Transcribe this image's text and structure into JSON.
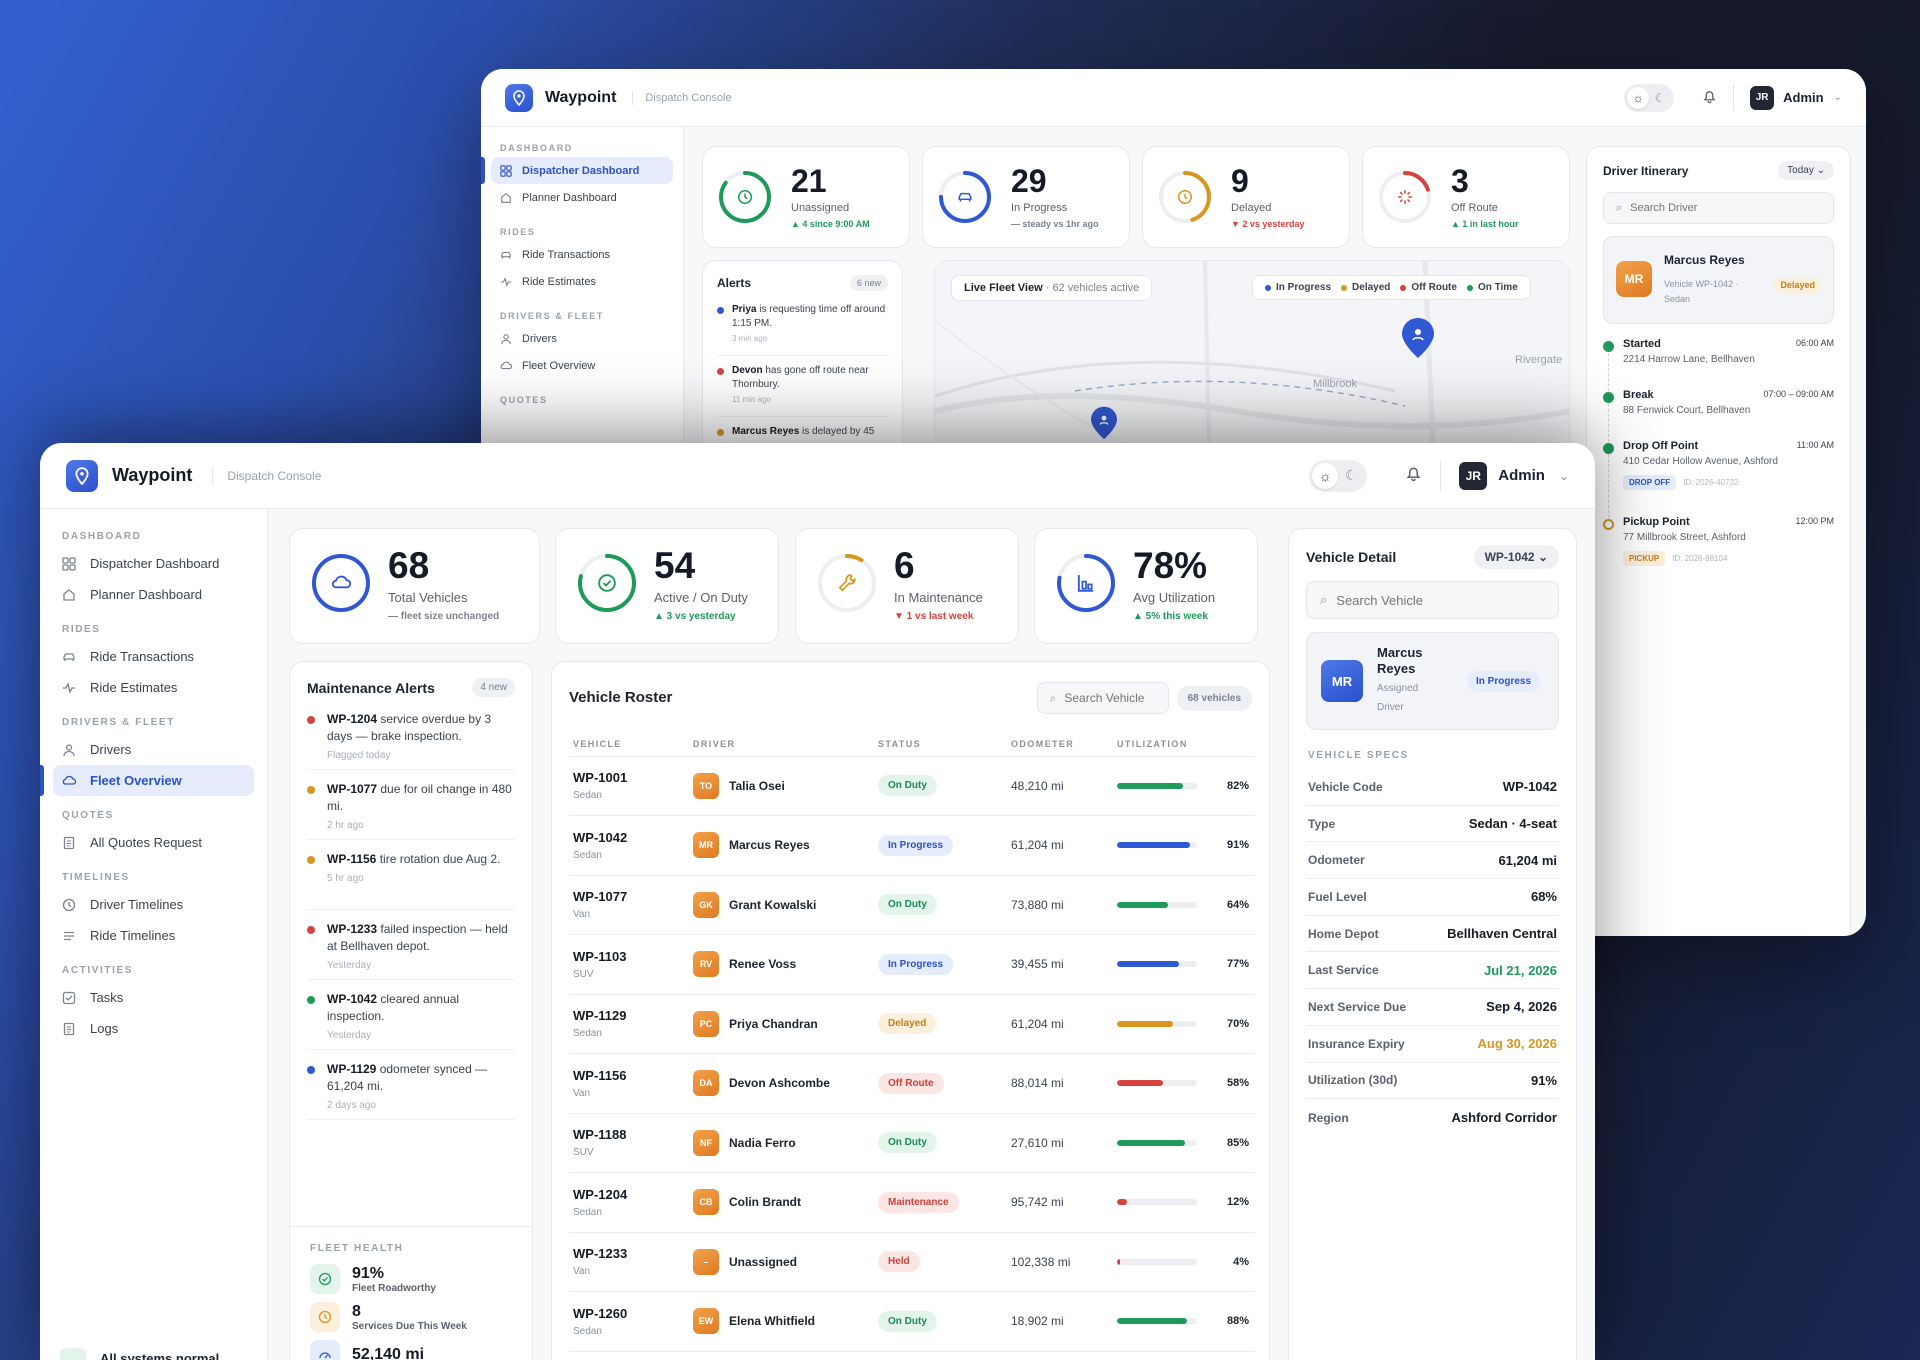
{
  "brand": {
    "name": "Waypoint",
    "subtitle": "Dispatch Console"
  },
  "admin": {
    "initials": "JR",
    "name": "Admin"
  },
  "colors": {
    "accent": "#2d52c6",
    "green": "#1e9a5b",
    "amber": "#d9961f",
    "red": "#d6433e",
    "blue": "#3158d3"
  },
  "back": {
    "sidebar": {
      "sections": [
        {
          "title": "DASHBOARD",
          "items": [
            {
              "label": "Dispatcher Dashboard",
              "icon": "grid-icon",
              "active": true
            },
            {
              "label": "Planner Dashboard",
              "icon": "home-icon"
            }
          ]
        },
        {
          "title": "RIDES",
          "items": [
            {
              "label": "Ride Transactions",
              "icon": "car-icon"
            },
            {
              "label": "Ride Estimates",
              "icon": "pulse-icon"
            }
          ]
        },
        {
          "title": "DRIVERS & FLEET",
          "items": [
            {
              "label": "Drivers",
              "icon": "person-icon"
            },
            {
              "label": "Fleet Overview",
              "icon": "cloud-icon"
            }
          ]
        },
        {
          "title": "QUOTES",
          "items": []
        }
      ]
    },
    "kpis": [
      {
        "num": "21",
        "label": "Unassigned",
        "delta": "▲ 4 since 9:00 AM",
        "trend": "up",
        "icon": "clock-icon",
        "ring": "#1e9a5b",
        "fill": 0.85
      },
      {
        "num": "29",
        "label": "In Progress",
        "delta": "— steady vs 1hr ago",
        "trend": "flat",
        "icon": "car-icon",
        "ring": "#3158d3",
        "fill": 0.75
      },
      {
        "num": "9",
        "label": "Delayed",
        "delta": "▼ 2 vs yesterday",
        "trend": "down",
        "icon": "clock-icon",
        "ring": "#d9961f",
        "fill": 0.45
      },
      {
        "num": "3",
        "label": "Off Route",
        "delta": "▲ 1 in last hour",
        "trend": "up",
        "icon": "spinner-icon",
        "ring": "#d6433e",
        "fill": 0.2
      }
    ],
    "alerts": {
      "title": "Alerts",
      "badge": "6 new",
      "items": [
        {
          "bold": "Priya",
          "text": " is requesting time off around 1:15 PM.",
          "time": "3 min ago",
          "color": "#3158d3"
        },
        {
          "bold": "Devon",
          "text": " has gone off route near Thornbury.",
          "time": "11 min ago",
          "color": "#d6433e"
        },
        {
          "bold": "Marcus Reyes",
          "text": " is delayed by 45",
          "time": "",
          "color": "#d9961f"
        }
      ]
    },
    "map": {
      "title": "Live Fleet View",
      "subtitle": " · 62 vehicles active",
      "legend": [
        {
          "label": "In Progress",
          "color": "#3158d3"
        },
        {
          "label": "Delayed",
          "color": "#d9961f"
        },
        {
          "label": "Off Route",
          "color": "#d6433e"
        },
        {
          "label": "On Time",
          "color": "#1e9a5b"
        }
      ],
      "places": [
        "Millbrook",
        "Rivergate"
      ]
    },
    "itinerary": {
      "title": "Driver Itinerary",
      "range": "Today",
      "search_placeholder": "Search Driver",
      "driver": {
        "initials": "MR",
        "name": "Marcus Reyes",
        "vehicle": "Vehicle WP-1042 · Sedan",
        "status": "Delayed"
      },
      "stops": [
        {
          "title": "Started",
          "time": "06:00 AM",
          "addr": "2214 Harrow Lane, Bellhaven",
          "tag": "",
          "id": "",
          "color": "#1e9a5b",
          "hollow": false
        },
        {
          "title": "Break",
          "time": "07:00 – 09:00 AM",
          "addr": "88 Fenwick Court, Bellhaven",
          "tag": "",
          "id": "",
          "color": "#1e9a5b",
          "hollow": false
        },
        {
          "title": "Drop Off Point",
          "time": "11:00 AM",
          "addr": "410 Cedar Hollow Avenue, Ashford",
          "tag": "DROP OFF",
          "id": "ID: 2026-40732",
          "color": "#1e9a5b",
          "hollow": false
        },
        {
          "title": "Pickup Point",
          "time": "12:00 PM",
          "addr": "77 Millbrook Street, Ashford",
          "tag": "PICKUP",
          "id": "ID: 2026-88104",
          "color": "#d9961f",
          "hollow": true
        }
      ]
    }
  },
  "front": {
    "sidebar": {
      "sections": [
        {
          "title": "DASHBOARD",
          "items": [
            {
              "label": "Dispatcher Dashboard",
              "icon": "grid-icon"
            },
            {
              "label": "Planner Dashboard",
              "icon": "home-icon"
            }
          ]
        },
        {
          "title": "RIDES",
          "items": [
            {
              "label": "Ride Transactions",
              "icon": "car-icon"
            },
            {
              "label": "Ride Estimates",
              "icon": "pulse-icon"
            }
          ]
        },
        {
          "title": "DRIVERS & FLEET",
          "items": [
            {
              "label": "Drivers",
              "icon": "person-icon"
            },
            {
              "label": "Fleet Overview",
              "icon": "cloud-icon",
              "active": true
            }
          ]
        },
        {
          "title": "QUOTES",
          "items": [
            {
              "label": "All Quotes Request",
              "icon": "document-icon"
            }
          ]
        },
        {
          "title": "TIMELINES",
          "items": [
            {
              "label": "Driver Timelines",
              "icon": "clock-icon"
            },
            {
              "label": "Ride Timelines",
              "icon": "lines-icon"
            }
          ]
        },
        {
          "title": "ACTIVITIES",
          "items": [
            {
              "label": "Tasks",
              "icon": "checkbox-icon"
            },
            {
              "label": "Logs",
              "icon": "document-icon"
            }
          ]
        }
      ],
      "footer": "All systems normal"
    },
    "kpis": [
      {
        "num": "68",
        "label": "Total Vehicles",
        "delta": "— fleet size unchanged",
        "trend": "flat",
        "icon": "cloud-icon",
        "ring": "#3158d3",
        "fill": 1
      },
      {
        "num": "54",
        "label": "Active / On Duty",
        "delta": "▲ 3 vs yesterday",
        "trend": "up",
        "icon": "check-circle-icon",
        "ring": "#1e9a5b",
        "fill": 0.79
      },
      {
        "num": "6",
        "label": "In Maintenance",
        "delta": "▼ 1 vs last week",
        "trend": "down",
        "icon": "wrench-icon",
        "ring": "#d9961f",
        "fill": 0.09
      },
      {
        "num": "78%",
        "label": "Avg Utilization",
        "delta": "▲ 5% this week",
        "trend": "up",
        "icon": "chart-icon",
        "ring": "#3158d3",
        "fill": 0.78
      }
    ],
    "maintenance": {
      "title": "Maintenance Alerts",
      "badge": "4 new",
      "items": [
        {
          "bold": "WP-1204",
          "text": " service overdue by 3 days — brake inspection.",
          "time": "Flagged today",
          "color": "#d6433e"
        },
        {
          "bold": "WP-1077",
          "text": " due for oil change in 480 mi.",
          "time": "2 hr ago",
          "color": "#d9961f"
        },
        {
          "bold": "WP-1156",
          "text": " tire rotation due Aug 2.",
          "time": "5 hr ago",
          "color": "#d9961f"
        },
        {
          "bold": "WP-1233",
          "text": " failed inspection — held at Bellhaven depot.",
          "time": "Yesterday",
          "color": "#d6433e"
        },
        {
          "bold": "WP-1042",
          "text": " cleared annual inspection.",
          "time": "Yesterday",
          "color": "#1e9a5b"
        },
        {
          "bold": "WP-1129",
          "text": " odometer synced — 61,204 mi.",
          "time": "2 days ago",
          "color": "#3158d3"
        }
      ],
      "health_title": "FLEET HEALTH",
      "health": [
        {
          "value": "91%",
          "label": "Fleet Roadworthy",
          "icon": "check-circle-icon",
          "color": "#1e9a5b",
          "bg": "#e3f5ea"
        },
        {
          "value": "8",
          "label": "Services Due This Week",
          "icon": "clock-icon",
          "color": "#d9961f",
          "bg": "#fcefdc"
        },
        {
          "value": "52,140 mi",
          "label": "",
          "icon": "gauge-icon",
          "color": "#3158d3",
          "bg": "#e5ecfc"
        }
      ]
    },
    "roster": {
      "title": "Vehicle Roster",
      "search_placeholder": "Search Vehicle",
      "count": "68 vehicles",
      "columns": [
        "VEHICLE",
        "DRIVER",
        "STATUS",
        "ODOMETER",
        "UTILIZATION"
      ],
      "rows": [
        {
          "id": "WP-1001",
          "type": "Sedan",
          "initials": "TO",
          "driver": "Talia Osei",
          "status": "On Duty",
          "tone": "green",
          "odo": "48,210 mi",
          "util": 82
        },
        {
          "id": "WP-1042",
          "type": "Sedan",
          "initials": "MR",
          "driver": "Marcus Reyes",
          "status": "In Progress",
          "tone": "blue",
          "odo": "61,204 mi",
          "util": 91
        },
        {
          "id": "WP-1077",
          "type": "Van",
          "initials": "GK",
          "driver": "Grant Kowalski",
          "status": "On Duty",
          "tone": "green",
          "odo": "73,880 mi",
          "util": 64
        },
        {
          "id": "WP-1103",
          "type": "SUV",
          "initials": "RV",
          "driver": "Renee Voss",
          "status": "In Progress",
          "tone": "blue",
          "odo": "39,455 mi",
          "util": 77
        },
        {
          "id": "WP-1129",
          "type": "Sedan",
          "initials": "PC",
          "driver": "Priya Chandran",
          "status": "Delayed",
          "tone": "amber",
          "odo": "61,204 mi",
          "util": 70
        },
        {
          "id": "WP-1156",
          "type": "Van",
          "initials": "DA",
          "driver": "Devon Ashcombe",
          "status": "Off Route",
          "tone": "red",
          "odo": "88,014 mi",
          "util": 58
        },
        {
          "id": "WP-1188",
          "type": "SUV",
          "initials": "NF",
          "driver": "Nadia Ferro",
          "status": "On Duty",
          "tone": "green",
          "odo": "27,610 mi",
          "util": 85
        },
        {
          "id": "WP-1204",
          "type": "Sedan",
          "initials": "CB",
          "driver": "Colin Brandt",
          "status": "Maintenance",
          "tone": "red",
          "odo": "95,742 mi",
          "util": 12
        },
        {
          "id": "WP-1233",
          "type": "Van",
          "initials": "–",
          "driver": "Unassigned",
          "status": "Held",
          "tone": "red",
          "odo": "102,338 mi",
          "util": 4
        },
        {
          "id": "WP-1260",
          "type": "Sedan",
          "initials": "EW",
          "driver": "Elena Whitfield",
          "status": "On Duty",
          "tone": "green",
          "odo": "18,902 mi",
          "util": 88
        }
      ]
    },
    "detail": {
      "title": "Vehicle Detail",
      "selected": "WP-1042",
      "search_placeholder": "Search Vehicle",
      "driver": {
        "initials": "MR",
        "name": "Marcus Reyes",
        "role": "Assigned Driver",
        "status": "In Progress"
      },
      "specs_title": "VEHICLE SPECS",
      "specs": [
        {
          "k": "Vehicle Code",
          "v": "WP-1042",
          "tone": ""
        },
        {
          "k": "Type",
          "v": "Sedan · 4-seat",
          "tone": ""
        },
        {
          "k": "Odometer",
          "v": "61,204 mi",
          "tone": ""
        },
        {
          "k": "Fuel Level",
          "v": "68%",
          "tone": ""
        },
        {
          "k": "Home Depot",
          "v": "Bellhaven Central",
          "tone": ""
        },
        {
          "k": "Last Service",
          "v": "Jul 21, 2026",
          "tone": "green"
        },
        {
          "k": "Next Service Due",
          "v": "Sep 4, 2026",
          "tone": ""
        },
        {
          "k": "Insurance Expiry",
          "v": "Aug 30, 2026",
          "tone": "amber"
        },
        {
          "k": "Utilization (30d)",
          "v": "91%",
          "tone": ""
        },
        {
          "k": "Region",
          "v": "Ashford Corridor",
          "tone": ""
        }
      ]
    }
  }
}
